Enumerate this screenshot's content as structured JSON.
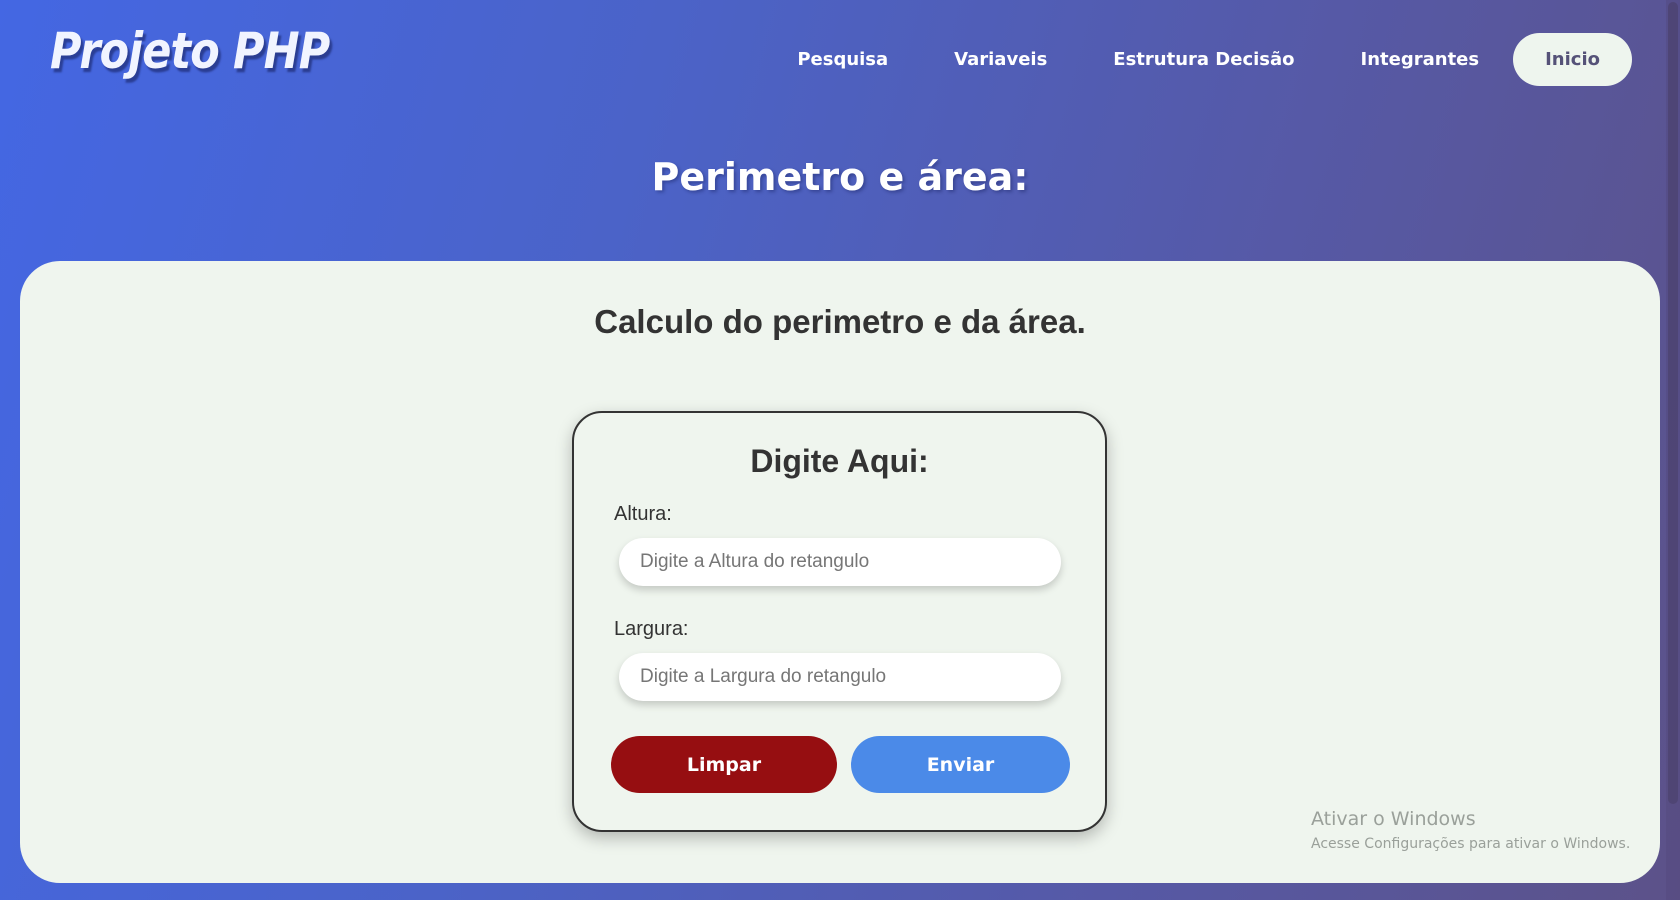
{
  "header": {
    "logo": "Projeto PHP",
    "nav": [
      {
        "label": "Pesquisa"
      },
      {
        "label": "Variaveis"
      },
      {
        "label": "Estrutura Decisão"
      },
      {
        "label": "Integrantes"
      },
      {
        "label": "Inicio",
        "active": true
      }
    ]
  },
  "page_title": "Perimetro e área:",
  "main": {
    "title": "Calculo do perimetro e da área.",
    "form": {
      "title": "Digite Aqui:",
      "height_label": "Altura:",
      "height_placeholder": "Digite a Altura do retangulo",
      "height_value": "",
      "width_label": "Largura:",
      "width_placeholder": "Digite a Largura do retangulo",
      "width_value": "",
      "clear_label": "Limpar",
      "send_label": "Enviar"
    }
  },
  "watermark": {
    "title": "Ativar o Windows",
    "subtitle": "Acesse Configurações para ativar o Windows."
  },
  "colors": {
    "clear_button": "#960e11",
    "send_button": "#4b8ae8",
    "panel_bg": "#eff5ee"
  }
}
